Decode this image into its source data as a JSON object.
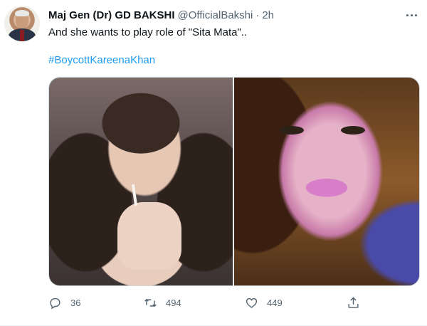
{
  "tweet": {
    "author_name": "Maj Gen (Dr) GD BAKSHI",
    "handle": "@OfficialBakshi",
    "separator": "·",
    "time": "2h",
    "text": "And she wants to play role of \"Sita Mata\"..",
    "hashtag": "#BoycottKareenaKhan"
  },
  "actions": {
    "reply_count": "36",
    "retweet_count": "494",
    "like_count": "449"
  },
  "icons": {
    "more": "more-horizontal-icon",
    "reply": "reply-icon",
    "retweet": "retweet-icon",
    "like": "heart-icon",
    "share": "share-icon"
  },
  "colors": {
    "link": "#1d9bf0",
    "secondary_text": "#536471",
    "primary_text": "#0f1419",
    "border": "#cfd9de"
  }
}
